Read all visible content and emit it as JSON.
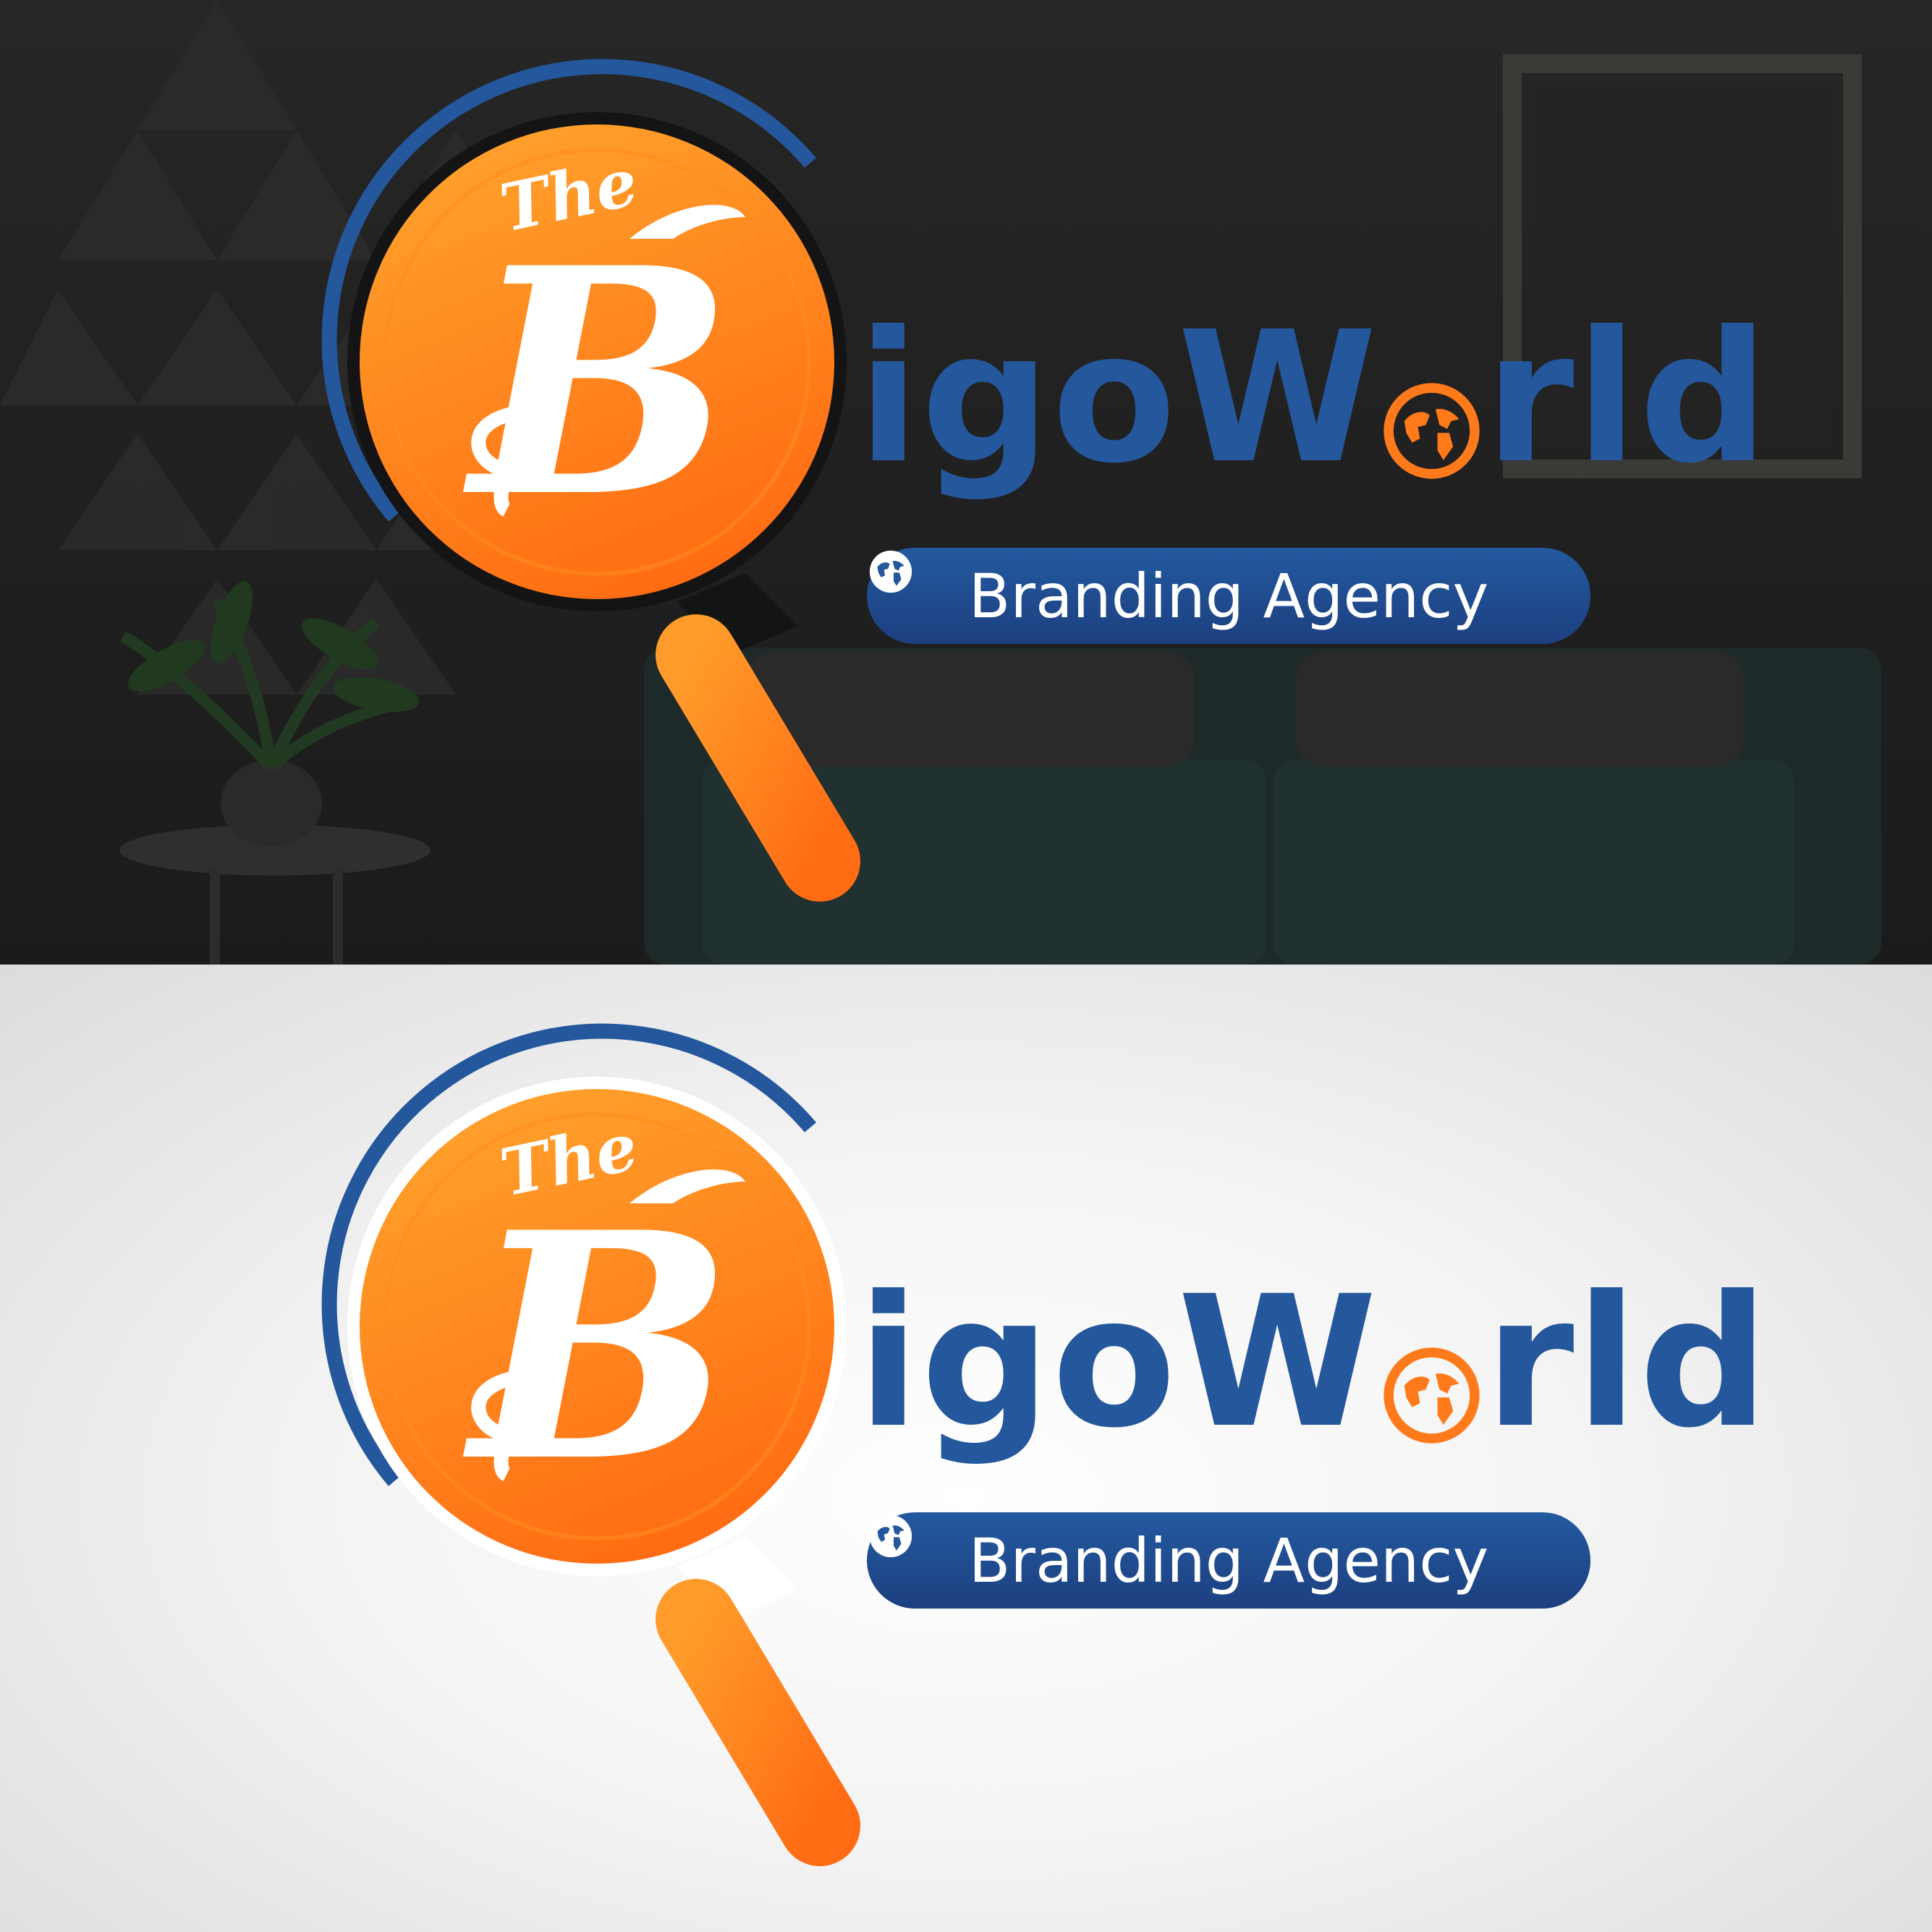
{
  "brand": {
    "emblem_small": "The",
    "emblem_letter": "B",
    "wordmark_before_globe": "igoW",
    "wordmark_after_globe": "rld",
    "tagline": "Branding Agency"
  },
  "icons": {
    "magnifier": "magnifying-glass-icon",
    "wordmark_o": "globe-icon",
    "tagline_left": "globe-icon",
    "tagline_right": "globe-icon"
  },
  "colors": {
    "orange": "#ff7a1a",
    "orange_light": "#ff9a2a",
    "blue": "#24579b",
    "blue_dark": "#1d3f7f",
    "dark_bg": "#1f1f1f",
    "light_bg": "#e6e6e6",
    "white": "#ffffff"
  }
}
